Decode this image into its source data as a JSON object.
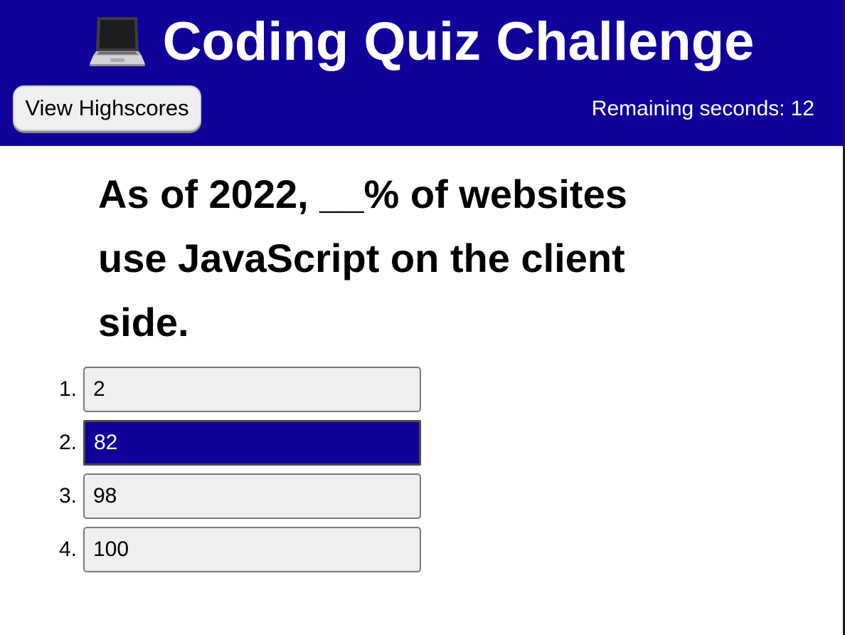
{
  "header": {
    "title": "Coding Quiz Challenge",
    "title_icon": "laptop-icon",
    "highscores_label": "View Highscores",
    "timer_label": "Remaining seconds:",
    "timer_value": "12"
  },
  "question": {
    "text": "As of 2022, __% of websites use JavaScript on the client side."
  },
  "answers": [
    {
      "number": "1.",
      "label": "2",
      "selected": false
    },
    {
      "number": "2.",
      "label": "82",
      "selected": true
    },
    {
      "number": "3.",
      "label": "98",
      "selected": false
    },
    {
      "number": "4.",
      "label": "100",
      "selected": false
    }
  ],
  "colors": {
    "header_background": "#10009a",
    "selected_answer_background": "#10009a",
    "answer_background": "#efefef"
  }
}
